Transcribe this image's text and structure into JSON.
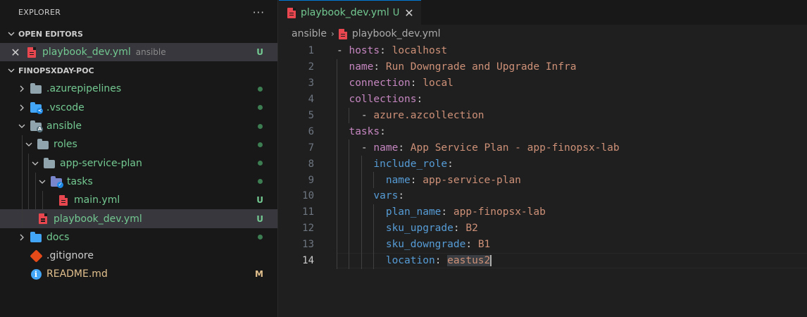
{
  "explorer": {
    "title": "EXPLORER",
    "more": "···"
  },
  "open_editors": {
    "header": "OPEN EDITORS",
    "items": [
      {
        "name": "playbook_dev.yml",
        "desc": "ansible",
        "status": "U"
      }
    ]
  },
  "workspace": {
    "header": "FINOPSXDAY-POC",
    "tree": [
      {
        "name": ".azurepipelines",
        "level": 0,
        "kind": "folder",
        "status": "dot"
      },
      {
        "name": ".vscode",
        "level": 0,
        "kind": "folder",
        "status": "dot"
      },
      {
        "name": "ansible",
        "level": 0,
        "kind": "folder-open",
        "status": "dot"
      },
      {
        "name": "roles",
        "level": 1,
        "kind": "folder-open",
        "status": "dot"
      },
      {
        "name": "app-service-plan",
        "level": 2,
        "kind": "folder-open",
        "status": "dot"
      },
      {
        "name": "tasks",
        "level": 3,
        "kind": "folder-open",
        "status": "dot"
      },
      {
        "name": "main.yml",
        "level": 4,
        "kind": "file",
        "status": "U"
      },
      {
        "name": "playbook_dev.yml",
        "level": 1,
        "kind": "file",
        "status": "U"
      },
      {
        "name": "docs",
        "level": 0,
        "kind": "folder",
        "status": "dot"
      },
      {
        "name": ".gitignore",
        "level": 0,
        "kind": "file",
        "status": ""
      },
      {
        "name": "README.md",
        "level": 0,
        "kind": "file",
        "status": "M"
      }
    ]
  },
  "tab": {
    "label": "playbook_dev.yml",
    "status": "U",
    "close": "✕"
  },
  "breadcrumbs": {
    "folder": "ansible",
    "sep": "›",
    "file": "playbook_dev.yml"
  },
  "code": {
    "line_numbers": [
      "1",
      "2",
      "3",
      "4",
      "5",
      "6",
      "7",
      "8",
      "9",
      "10",
      "11",
      "12",
      "13",
      "14"
    ],
    "lines": [
      [
        "- ",
        "hosts",
        ": ",
        "localhost"
      ],
      [
        "  ",
        "name",
        ": ",
        "Run Downgrade and Upgrade Infra"
      ],
      [
        "  ",
        "connection",
        ": ",
        "local"
      ],
      [
        "  ",
        "collections",
        ":",
        ""
      ],
      [
        "    - ",
        "",
        "",
        "azure.azcollection"
      ],
      [
        "  ",
        "tasks",
        ":",
        ""
      ],
      [
        "    - ",
        "name",
        ": ",
        "App Service Plan - app-finopsx-lab"
      ],
      [
        "      ",
        "include_role",
        ":",
        ""
      ],
      [
        "        ",
        "name",
        ": ",
        "app-service-plan"
      ],
      [
        "      ",
        "vars",
        ":",
        ""
      ],
      [
        "        ",
        "plan_name",
        ": ",
        "app-finopsx-lab"
      ],
      [
        "        ",
        "sku_upgrade",
        ": ",
        "B2"
      ],
      [
        "        ",
        "sku_downgrade",
        ": ",
        "B1"
      ],
      [
        "        ",
        "location",
        ": ",
        "eastus2"
      ]
    ]
  },
  "colors": {
    "untracked": "#73c991",
    "modified": "#e2c08d",
    "key": "#569cd6",
    "string": "#ce9178",
    "accent": "#0078d4"
  }
}
